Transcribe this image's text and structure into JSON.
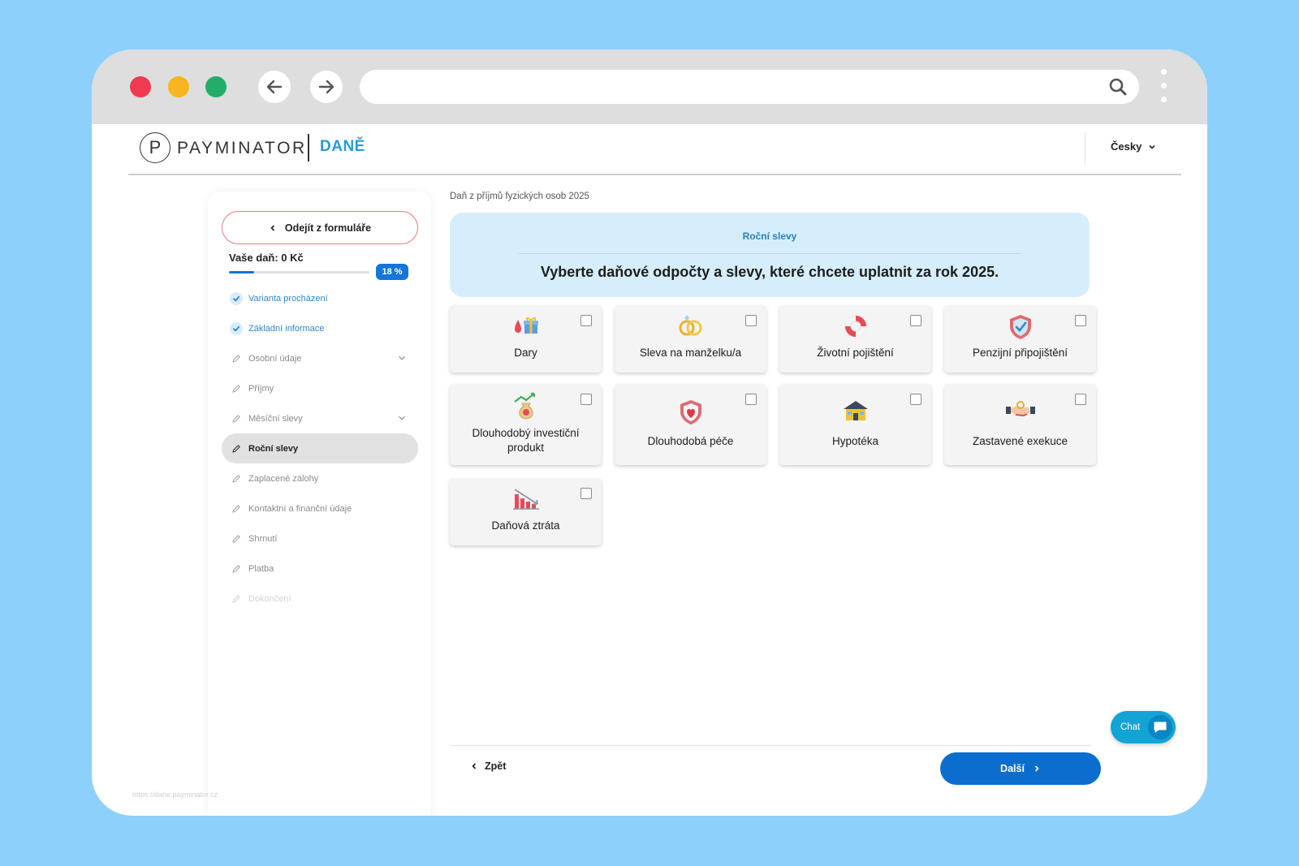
{
  "browser": {
    "url": "",
    "status_url": "https://dane.payminator.cz"
  },
  "header": {
    "logo_letter": "P",
    "brand": "PAYMINATOR",
    "product": "DANĚ",
    "language": "Česky"
  },
  "sidebar": {
    "exit_label": "Odejít z formuláře",
    "tax_label": "Vaše daň: 0 Kč",
    "progress_percent": 18,
    "progress_label": "18 %",
    "steps": [
      {
        "label": "Varianta procházení",
        "state": "done",
        "expandable": false
      },
      {
        "label": "Základní informace",
        "state": "done",
        "expandable": false
      },
      {
        "label": "Osobní údaje",
        "state": "pending",
        "expandable": true
      },
      {
        "label": "Příjmy",
        "state": "pending",
        "expandable": false
      },
      {
        "label": "Měsíční slevy",
        "state": "pending",
        "expandable": true
      },
      {
        "label": "Roční slevy",
        "state": "active",
        "expandable": false
      },
      {
        "label": "Zaplacené zálohy",
        "state": "pending",
        "expandable": false
      },
      {
        "label": "Kontaktní a finanční údaje",
        "state": "pending",
        "expandable": false
      },
      {
        "label": "Shrnutí",
        "state": "pending",
        "expandable": false
      },
      {
        "label": "Platba",
        "state": "pending",
        "expandable": false
      },
      {
        "label": "Dokončení",
        "state": "disabled",
        "expandable": false
      }
    ]
  },
  "main": {
    "breadcrumb": "Daň z příjmů fyzických osob 2025",
    "section_label": "Roční slevy",
    "title": "Vyberte daňové odpočty a slevy, které chcete uplatnit za rok 2025.",
    "cards": [
      {
        "label": "Dary",
        "icon": "gift-icon",
        "checked": false
      },
      {
        "label": "Sleva na manželku/a",
        "icon": "rings-icon",
        "checked": false
      },
      {
        "label": "Životní pojištění",
        "icon": "lifebuoy-icon",
        "checked": false
      },
      {
        "label": "Penzijní připojištění",
        "icon": "shield-check-icon",
        "checked": false
      },
      {
        "label": "Dlouhodobý investiční produkt",
        "icon": "money-bag-icon",
        "checked": false
      },
      {
        "label": "Dlouhodobá péče",
        "icon": "heart-shield-icon",
        "checked": false
      },
      {
        "label": "Hypotéka",
        "icon": "house-icon",
        "checked": false
      },
      {
        "label": "Zastavené exekuce",
        "icon": "handshake-icon",
        "checked": false
      },
      {
        "label": "Daňová ztráta",
        "icon": "chart-down-icon",
        "checked": false
      }
    ]
  },
  "footer": {
    "back_label": "Zpět",
    "next_label": "Další"
  },
  "chat": {
    "label": "Chat"
  },
  "colors": {
    "primary": "#0b6ecf",
    "accent": "#2a9bd6",
    "hero_bg": "#d6eefb",
    "background": "#8dd0fb"
  }
}
